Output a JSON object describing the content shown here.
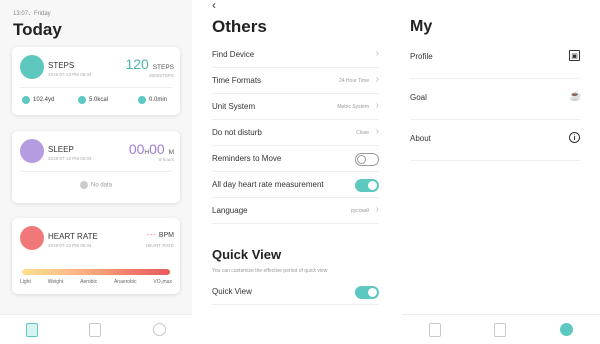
{
  "today": {
    "date": "13:07、Friday",
    "title": "Today",
    "steps": {
      "name": "STEPS",
      "date": "2019-07-13 PM 05:04",
      "value": "120",
      "unit": "STEPS",
      "goal": "8000STEPS",
      "distance": "102.4yd",
      "calories": "5.0kcal",
      "duration": "0.0min"
    },
    "sleep": {
      "name": "SLEEP",
      "date": "2019-07-13 PM 02:03",
      "hours": "00",
      "h_unit": "H",
      "minutes": "00",
      "m_unit": "M",
      "sub": "8 hours",
      "nodata": "No data"
    },
    "heart_rate": {
      "name": "HEART RATE",
      "date": "2019-07-13 PM 05:04",
      "value": "---",
      "unit": "BPM",
      "sub": "HEART RATE",
      "zones": [
        "Light",
        "Weight",
        "Aerobic",
        "Anaerobic",
        "VO₂max"
      ]
    }
  },
  "others": {
    "title": "Others",
    "rows": [
      {
        "label": "Find Device",
        "value": "",
        "control": "chevron"
      },
      {
        "label": "Time Formats",
        "value": "24 Hour Time",
        "control": "chevron"
      },
      {
        "label": "Unit System",
        "value": "Metric System",
        "control": "chevron"
      },
      {
        "label": "Do not disturb",
        "value": "Close",
        "control": "chevron"
      },
      {
        "label": "Reminders to Move",
        "value": "",
        "control": "toggle-off"
      },
      {
        "label": "All day heart rate measurement",
        "value": "",
        "control": "toggle-on"
      },
      {
        "label": "Language",
        "value": "русский",
        "control": "chevron"
      }
    ],
    "quick_view": {
      "title": "Quick View",
      "subtitle": "You can customize the effective period of quick view",
      "row_label": "Quick View"
    }
  },
  "my": {
    "title": "My",
    "items": [
      {
        "label": "Profile",
        "icon": "profile-card-icon"
      },
      {
        "label": "Goal",
        "icon": "trophy-icon"
      },
      {
        "label": "About",
        "icon": "info-icon"
      }
    ]
  },
  "colors": {
    "accent": "#5cc8c0",
    "sleep": "#b49ce0",
    "heart": "#f07878"
  }
}
